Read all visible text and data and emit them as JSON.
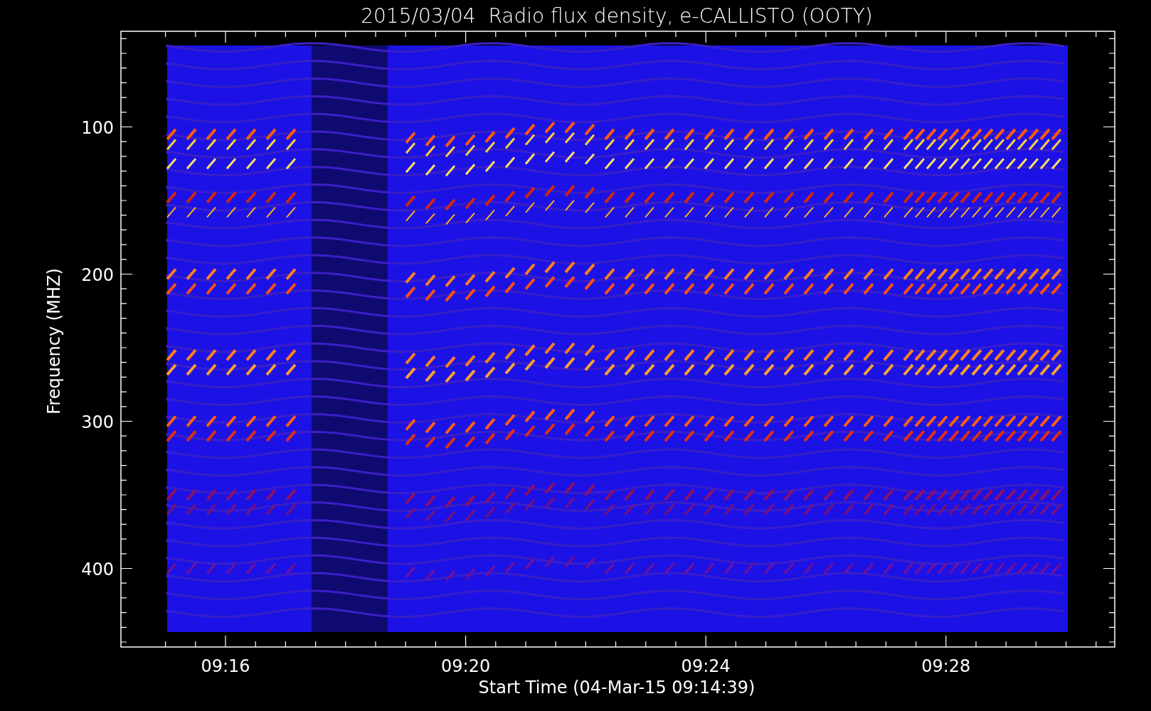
{
  "title": "2015/03/04  Radio flux density, e-CALLISTO (OOTY)",
  "y_axis": {
    "label": "Frequency (MHZ)",
    "tick_labels": [
      "100",
      "200",
      "300",
      "400"
    ]
  },
  "x_axis": {
    "label": "Start Time (04-Mar-15 09:14:39)",
    "tick_labels": [
      "09:16",
      "09:20",
      "09:24",
      "09:28"
    ]
  }
}
